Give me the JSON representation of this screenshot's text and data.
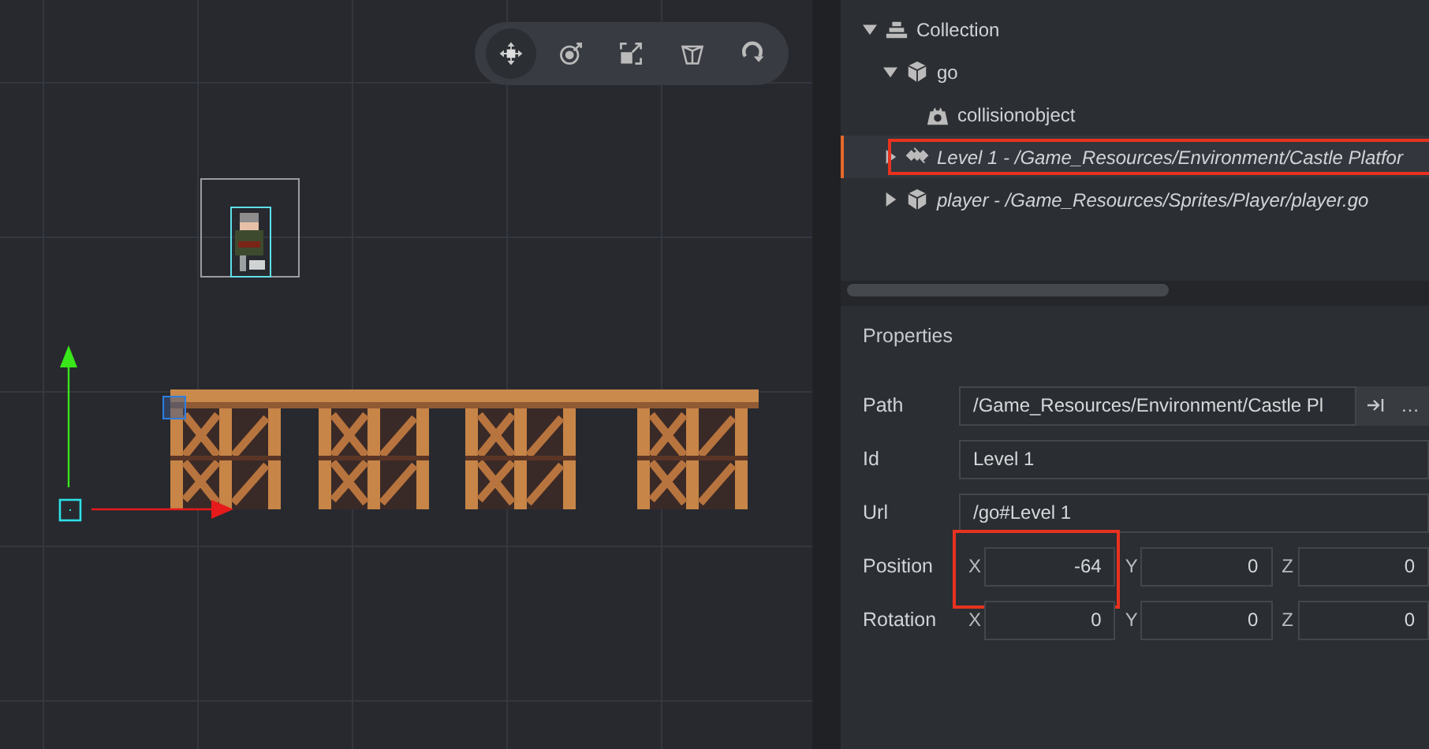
{
  "toolbar": {
    "tools": [
      {
        "kind": "move",
        "selected": true
      },
      {
        "kind": "rotate",
        "selected": false
      },
      {
        "kind": "scale",
        "selected": false
      },
      {
        "kind": "perspective",
        "selected": false
      },
      {
        "kind": "reload",
        "selected": false
      }
    ]
  },
  "outline": {
    "items": [
      {
        "label": "Collection",
        "kind": "collection",
        "italic": false,
        "expanded": true,
        "selected": false,
        "annotated": false,
        "children": [
          {
            "label": "go",
            "kind": "gameobject",
            "italic": false,
            "expanded": true,
            "selected": false,
            "annotated": false,
            "children": [
              {
                "label": "collisionobject",
                "kind": "collision",
                "italic": false,
                "selected": false,
                "annotated": false
              }
            ]
          },
          {
            "label": "Level 1 - /Game_Resources/Environment/Castle Platfor",
            "kind": "tilemap",
            "italic": true,
            "expanded": false,
            "selected": true,
            "annotated": true
          },
          {
            "label": "player - /Game_Resources/Sprites/Player/player.go",
            "kind": "gameobject",
            "italic": true,
            "expanded": false,
            "selected": false,
            "annotated": false
          }
        ]
      }
    ]
  },
  "properties": {
    "title": "Properties",
    "rows": [
      {
        "kind": "path",
        "label": "Path",
        "value": "/Game_Resources/Environment/Castle Pl",
        "more": "…"
      },
      {
        "kind": "text",
        "label": "Id",
        "value": "Level 1"
      },
      {
        "kind": "text",
        "label": "Url",
        "value": "/go#Level 1"
      },
      {
        "kind": "vector",
        "label": "Position",
        "fields": [
          {
            "axis": "X",
            "value": "-64",
            "annotated": true
          },
          {
            "axis": "Y",
            "value": "0",
            "annotated": false
          },
          {
            "axis": "Z",
            "value": "0",
            "annotated": false
          }
        ]
      },
      {
        "kind": "vector",
        "label": "Rotation",
        "fields": [
          {
            "axis": "X",
            "value": "0",
            "annotated": false
          },
          {
            "axis": "Y",
            "value": "0",
            "annotated": false
          },
          {
            "axis": "Z",
            "value": "0",
            "annotated": false
          }
        ]
      }
    ]
  }
}
